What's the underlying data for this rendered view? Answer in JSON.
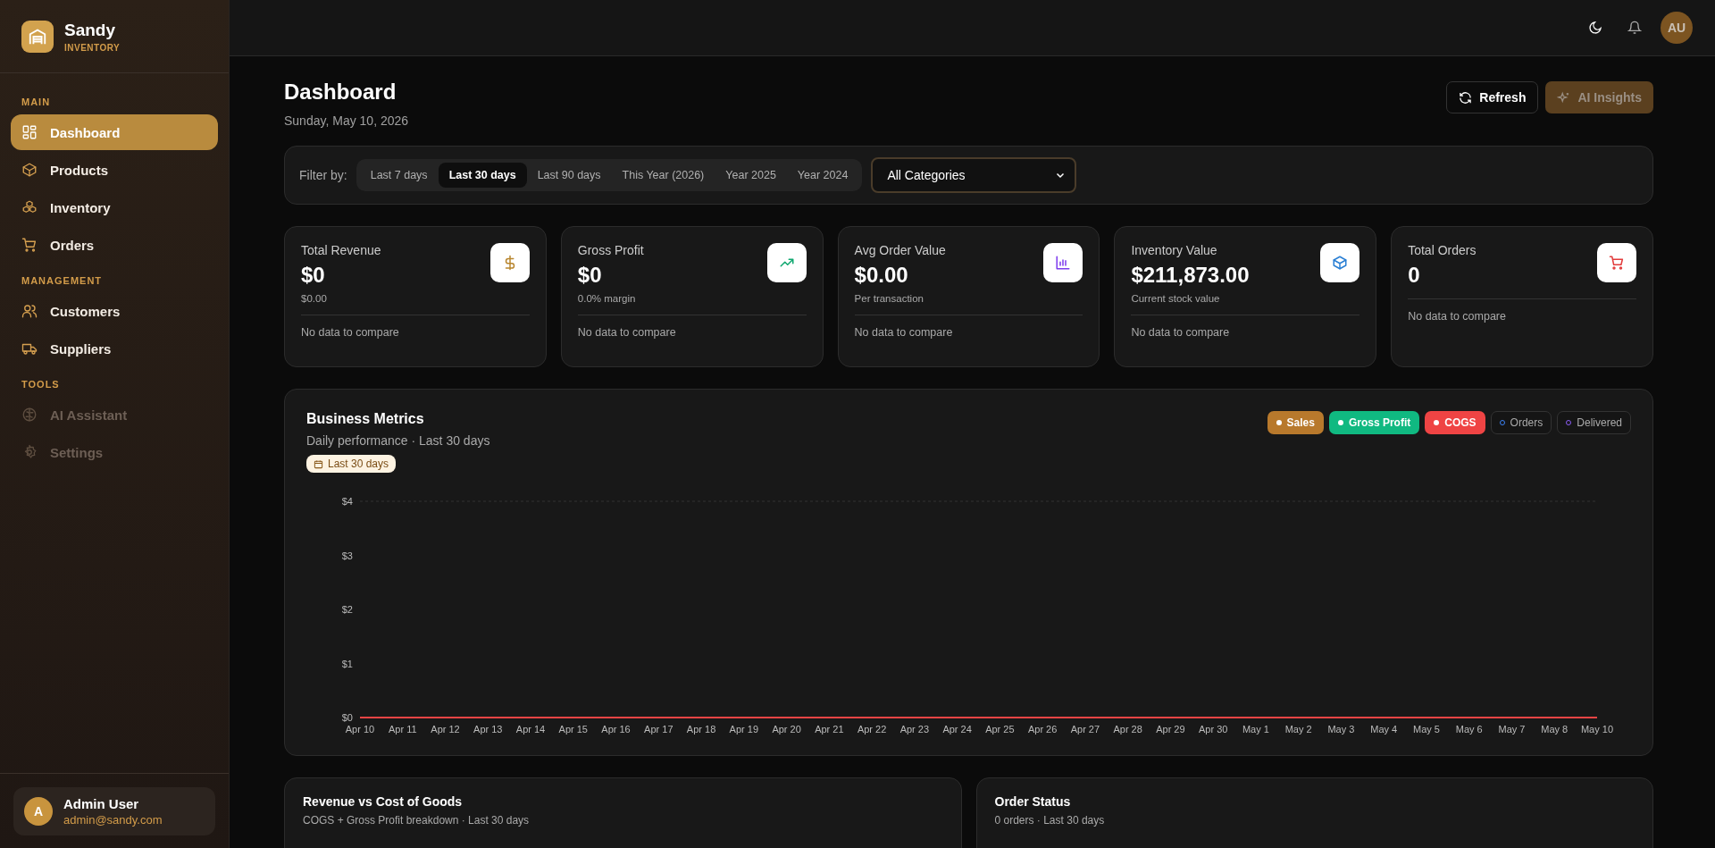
{
  "brand": {
    "name": "Sandy",
    "tagline": "INVENTORY"
  },
  "sidebar": {
    "sections": [
      {
        "title": "MAIN",
        "items": [
          {
            "label": "Dashboard",
            "selected": true,
            "disabled": false
          },
          {
            "label": "Products",
            "selected": false,
            "disabled": false
          },
          {
            "label": "Inventory",
            "selected": false,
            "disabled": false
          },
          {
            "label": "Orders",
            "selected": false,
            "disabled": false
          }
        ]
      },
      {
        "title": "MANAGEMENT",
        "items": [
          {
            "label": "Customers",
            "selected": false,
            "disabled": false
          },
          {
            "label": "Suppliers",
            "selected": false,
            "disabled": false
          }
        ]
      },
      {
        "title": "TOOLS",
        "items": [
          {
            "label": "AI Assistant",
            "selected": false,
            "disabled": true
          },
          {
            "label": "Settings",
            "selected": false,
            "disabled": true
          }
        ]
      }
    ],
    "user": {
      "initial": "A",
      "name": "Admin User",
      "email": "admin@sandy.com"
    }
  },
  "topbar": {
    "avatar": "AU"
  },
  "header": {
    "title": "Dashboard",
    "date": "Sunday, May 10, 2026",
    "buttons": [
      {
        "label": "Refresh",
        "kind": "outline"
      },
      {
        "label": "AI Insights",
        "kind": "accent"
      }
    ]
  },
  "filter": {
    "label": "Filter by:",
    "ranges": [
      {
        "label": "Last 7 days",
        "selected": false
      },
      {
        "label": "Last 30 days",
        "selected": true
      },
      {
        "label": "Last 90 days",
        "selected": false
      },
      {
        "label": "This Year (2026)",
        "selected": false
      },
      {
        "label": "Year 2025",
        "selected": false
      },
      {
        "label": "Year 2024",
        "selected": false
      }
    ],
    "category": "All Categories"
  },
  "kpis": [
    {
      "title": "Total Revenue",
      "value": "$0",
      "sub": "$0.00",
      "footer": "No data to compare",
      "color": "#b8862f"
    },
    {
      "title": "Gross Profit",
      "value": "$0",
      "sub": "0.0% margin",
      "footer": "No data to compare",
      "color": "#10a870"
    },
    {
      "title": "Avg Order Value",
      "value": "$0.00",
      "sub": "Per transaction",
      "footer": "No data to compare",
      "color": "#7c3aed"
    },
    {
      "title": "Inventory Value",
      "value": "$211,873.00",
      "sub": "Current stock value",
      "footer": "No data to compare",
      "color": "#2a7fd4"
    },
    {
      "title": "Total Orders",
      "value": "0",
      "footer": "No data to compare",
      "color": "#e23b3b"
    }
  ],
  "metrics": {
    "title": "Business Metrics",
    "subtitle": "Daily performance · Last 30 days",
    "badge": "Last 30 days",
    "legend": [
      {
        "on": true
      },
      {
        "on": true
      },
      {
        "on": true
      },
      {
        "on": false
      },
      {
        "on": false
      }
    ],
    "chart_data": {
      "type": "line",
      "categories": [
        "Apr 10",
        "Apr 11",
        "Apr 12",
        "Apr 13",
        "Apr 14",
        "Apr 15",
        "Apr 16",
        "Apr 17",
        "Apr 18",
        "Apr 19",
        "Apr 20",
        "Apr 21",
        "Apr 22",
        "Apr 23",
        "Apr 24",
        "Apr 25",
        "Apr 26",
        "Apr 27",
        "Apr 28",
        "Apr 29",
        "Apr 30",
        "May 1",
        "May 2",
        "May 3",
        "May 4",
        "May 5",
        "May 6",
        "May 7",
        "May 8",
        "May 10"
      ],
      "ylim": [
        0,
        4
      ],
      "yticks": [
        {
          "value": 0,
          "label": "$0"
        },
        {
          "value": 1,
          "label": "$1"
        },
        {
          "value": 2,
          "label": "$2"
        },
        {
          "value": 3,
          "label": "$3"
        },
        {
          "value": 4,
          "label": "$4"
        }
      ],
      "series": [
        {
          "name": "Sales",
          "color": "#b8792c",
          "values": [
            null,
            null,
            null,
            null,
            null,
            null,
            null,
            null,
            null,
            null,
            null,
            null,
            null,
            null,
            null,
            null,
            null,
            null,
            null,
            null,
            null,
            null,
            null,
            null,
            null,
            null,
            null,
            null,
            null,
            null
          ]
        },
        {
          "name": "Gross Profit",
          "color": "#10b981",
          "values": [
            null,
            null,
            null,
            null,
            null,
            null,
            null,
            null,
            null,
            null,
            null,
            null,
            null,
            null,
            null,
            null,
            null,
            null,
            null,
            null,
            null,
            null,
            null,
            null,
            null,
            null,
            null,
            null,
            null,
            null
          ]
        },
        {
          "name": "COGS",
          "color": "#ef4444",
          "values": [
            0,
            0,
            0,
            0,
            0,
            0,
            0,
            0,
            0,
            0,
            0,
            0,
            0,
            0,
            0,
            0,
            0,
            0,
            0,
            0,
            0,
            0,
            0,
            0,
            0,
            0,
            0,
            0,
            0,
            0
          ]
        },
        {
          "name": "Orders",
          "color": "#3b82f6",
          "values": [
            null,
            null,
            null,
            null,
            null,
            null,
            null,
            null,
            null,
            null,
            null,
            null,
            null,
            null,
            null,
            null,
            null,
            null,
            null,
            null,
            null,
            null,
            null,
            null,
            null,
            null,
            null,
            null,
            null,
            null
          ]
        },
        {
          "name": "Delivered",
          "color": "#8b5cf6",
          "values": [
            null,
            null,
            null,
            null,
            null,
            null,
            null,
            null,
            null,
            null,
            null,
            null,
            null,
            null,
            null,
            null,
            null,
            null,
            null,
            null,
            null,
            null,
            null,
            null,
            null,
            null,
            null,
            null,
            null,
            null
          ]
        }
      ]
    }
  },
  "panels": [
    {
      "title": "Revenue vs Cost of Goods",
      "subtitle": "COGS + Gross Profit breakdown · Last 30 days"
    },
    {
      "title": "Order Status",
      "subtitle": "0 orders · Last 30 days"
    }
  ]
}
